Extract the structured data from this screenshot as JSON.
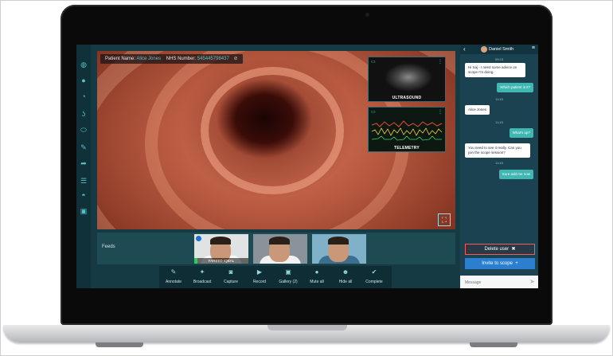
{
  "patient": {
    "name_label": "Patient Name:",
    "name": "Alice Jones",
    "nhs_label": "NHS Number:",
    "nhs": "545445798437"
  },
  "left_tools": [
    "globe-icon",
    "apple-icon",
    "droplet-icon",
    "stomach-icon",
    "capsule-icon",
    "pencil-icon",
    "share-arrow-icon",
    "menu-lines-icon",
    "drop-half-icon",
    "frame-icon"
  ],
  "insets": {
    "ultrasound": "ULTRASOUND",
    "telemetry": "TELEMETRY"
  },
  "feeds": {
    "label": "Feeds",
    "participants": [
      {
        "name": "FAREED IQBAL",
        "shirt": "#ffffff",
        "bg": "#dfe3e4"
      },
      {
        "name": "",
        "shirt": "#f2f2f2",
        "bg": "#8a9399"
      },
      {
        "name": "",
        "shirt": "#3b6e8f",
        "bg": "#7fb2c8"
      }
    ]
  },
  "actions": [
    {
      "label": "Annotate",
      "icon": "✎"
    },
    {
      "label": "Broadcast",
      "icon": "✦"
    },
    {
      "label": "Capture",
      "icon": "◙"
    },
    {
      "label": "Record",
      "icon": "▶"
    },
    {
      "label": "Gallery (2)",
      "icon": "▣"
    },
    {
      "label": "Mute all",
      "icon": "●"
    },
    {
      "label": "Hide all",
      "icon": "☻"
    },
    {
      "label": "Complete",
      "icon": "✔"
    }
  ],
  "chat": {
    "user": "Daniel Smith",
    "messages": [
      {
        "time": "09:15",
        "dir": "in",
        "text": "Hi Saj - I need some advice on scope I'm doing."
      },
      {
        "time": "",
        "dir": "out",
        "text": "Which patient is it?"
      },
      {
        "time": "11:43",
        "dir": "in",
        "text": "Alice Jones"
      },
      {
        "time": "11:43",
        "dir": "out",
        "text": "What's up?"
      },
      {
        "time": "",
        "dir": "in",
        "text": "You need to see it really. Can you join the scope session?"
      },
      {
        "time": "11:43",
        "dir": "out",
        "text": "Sure add me now"
      }
    ],
    "delete_label": "Delete user",
    "invite_label": "Invite to scope",
    "input_placeholder": "Message"
  },
  "colors": {
    "accent": "#4fc3d0",
    "panel": "#163a43",
    "chat_out": "#3fb7b3",
    "invite": "#2c7fcf",
    "delete_border": "#ff5757"
  }
}
